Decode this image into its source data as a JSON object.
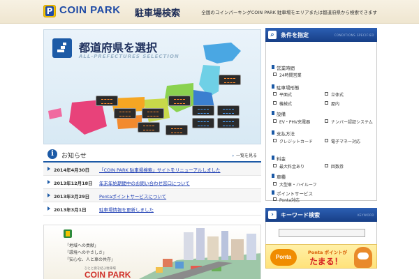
{
  "header": {
    "brand": "COIN PARK",
    "subtitle": "駐車場検索",
    "tagline": "全国のコインパーキングCOIN PARK 駐車場をエリアまたは都道府県から検索できます"
  },
  "map": {
    "title": "都道府県を選択",
    "subtitle": "ALL-PREFECTURES SELECTION"
  },
  "news": {
    "title": "お知らせ",
    "more_label": "一覧を見る",
    "items": [
      {
        "date": "2014年4月30日",
        "text": "「COIN PARK 駐車場検索」サイトをリニューアルしました"
      },
      {
        "date": "2013年12月18日",
        "text": "年末年始期間中のお問い合わせ窓口について"
      },
      {
        "date": "2013年3月29日",
        "text": "Pontaポイントサービスについて"
      },
      {
        "date": "2013年3月1日",
        "text": "駐車場情報を更新しました"
      }
    ]
  },
  "banner": {
    "line1": "「地域への貢献」",
    "line2": "「環境へのやさしさ」",
    "line3": "「安心な、人と車の共存」",
    "small": "ひとと街を結ぶ駐車場",
    "brand": "COIN PARK"
  },
  "conditions": {
    "title": "条件を指定",
    "title_en": "CONDITIONS SPECIFIED",
    "groups": [
      {
        "label": "営業時間",
        "items": [
          "24時間営業"
        ]
      },
      {
        "label": "駐車場形態",
        "items": [
          "平面式",
          "立体式",
          "機械式",
          "屋内"
        ]
      },
      {
        "label": "設備",
        "items": [
          "EV・PHV充電器",
          "ナンバー認証システム"
        ]
      },
      {
        "label": "支払方法",
        "items": [
          "クレジットカード",
          "電子マネー対応"
        ]
      },
      {
        "label": "料金",
        "items": [
          "最大料金あり",
          "回数券"
        ]
      },
      {
        "label": "車種",
        "items": [
          "大型車・ハイルーフ"
        ]
      },
      {
        "label": "ポイントサービス",
        "items": [
          "Ponta対応"
        ]
      }
    ]
  },
  "keyword": {
    "title": "キーワード検索",
    "title_en": "KEYWORD",
    "placeholder": ""
  },
  "ponta": {
    "logo": "Ponta",
    "line1": "Ponta ポイントが",
    "line2": "たまる！"
  },
  "colors": {
    "brand_blue": "#1c5aa6",
    "header_bg": "#f7f1e3",
    "link": "#1a3bb2"
  }
}
